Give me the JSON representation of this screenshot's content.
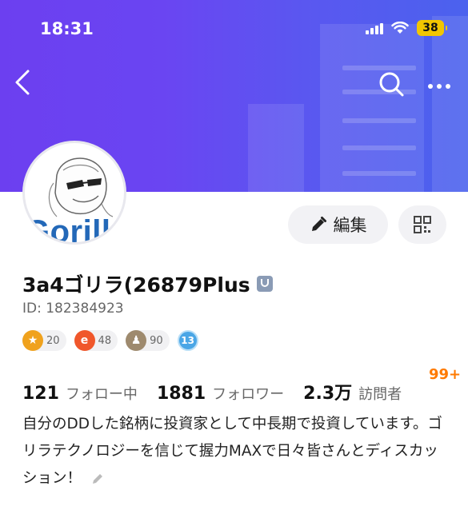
{
  "status_bar": {
    "time": "18:31",
    "battery": "38"
  },
  "header": {
    "back_icon": "chevron-left-icon",
    "search_icon": "search-icon",
    "more_icon": "more-dots-icon"
  },
  "avatar": {
    "text": "Gorillo"
  },
  "actions": {
    "edit_label": "編集",
    "edit_icon": "pencil-icon",
    "qr_icon": "qr-code-icon"
  },
  "profile": {
    "name": "3a4ゴリラ(26879Plus",
    "id_text": "ID: 182384923"
  },
  "badges": [
    {
      "icon": "star-medal-icon",
      "count": "20",
      "color": "#f0a21d"
    },
    {
      "icon": "shield-medal-icon",
      "count": "48",
      "color": "#f0572b"
    },
    {
      "icon": "group-medal-icon",
      "count": "90",
      "color": "#9e8a6e"
    }
  ],
  "level": "13",
  "stats": [
    {
      "value": "121",
      "label": "フォロー中"
    },
    {
      "value": "1881",
      "label": "フォロワー"
    },
    {
      "value": "2.3万",
      "label": "訪問者"
    }
  ],
  "notification_badge": "99+",
  "bio": "自分のDDした銘柄に投資家として中長期で投資しています。ゴリラテクノロジーを信じて握力MAXで日々皆さんとディスカッション！"
}
